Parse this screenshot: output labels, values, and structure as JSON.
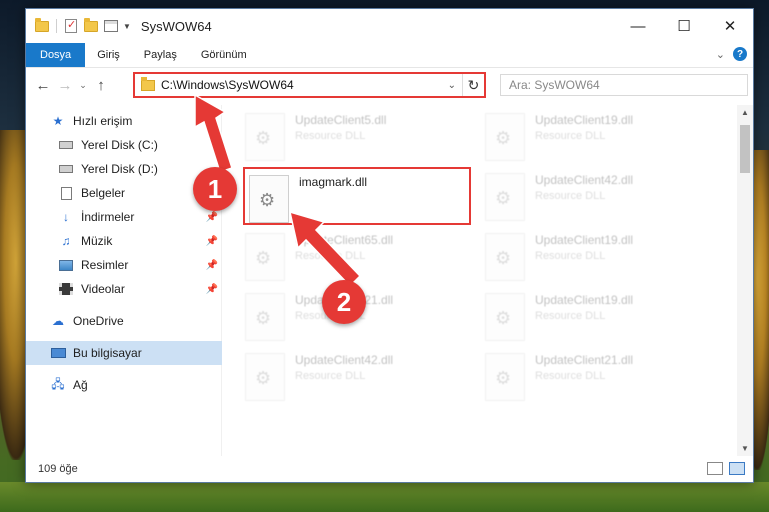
{
  "window": {
    "title": "SysWOW64"
  },
  "ribbon": {
    "tabs": [
      "Dosya",
      "Giriş",
      "Paylaş",
      "Görünüm"
    ],
    "help_label": "?"
  },
  "navigation": {
    "address": "C:\\Windows\\SysWOW64",
    "search_placeholder": "Ara: SysWOW64"
  },
  "sidebar": {
    "items": [
      {
        "label": "Hızlı erişim",
        "icon": "star-icon"
      },
      {
        "label": "Yerel Disk (C:)",
        "icon": "drive-icon"
      },
      {
        "label": "Yerel Disk (D:)",
        "icon": "drive-icon"
      },
      {
        "label": "Belgeler",
        "icon": "documents-icon"
      },
      {
        "label": "İndirmeler",
        "icon": "download-icon"
      },
      {
        "label": "Müzik",
        "icon": "music-icon"
      },
      {
        "label": "Resimler",
        "icon": "pictures-icon"
      },
      {
        "label": "Videolar",
        "icon": "video-icon"
      },
      {
        "label": "OneDrive",
        "icon": "cloud-icon"
      },
      {
        "label": "Bu bilgisayar",
        "icon": "computer-icon"
      },
      {
        "label": "Ağ",
        "icon": "network-icon"
      }
    ]
  },
  "files": [
    {
      "name": "UpdateClient5.dll",
      "desc": "Resource DLL"
    },
    {
      "name": "UpdateClient19.dll",
      "desc": "Resource DLL"
    },
    {
      "name": "imagmark.dll",
      "desc": ""
    },
    {
      "name": "UpdateClient42.dll",
      "desc": "Resource DLL"
    },
    {
      "name": "UpdateClient65.dll",
      "desc": "Resource DLL"
    },
    {
      "name": "UpdateClient19.dll",
      "desc": "Resource DLL"
    },
    {
      "name": "UpdateClient21.dll",
      "desc": "Resource DLL"
    },
    {
      "name": "UpdateClient19.dll",
      "desc": "Resource DLL"
    },
    {
      "name": "UpdateClient42.dll",
      "desc": "Resource DLL"
    },
    {
      "name": "UpdateClient21.dll",
      "desc": "Resource DLL"
    }
  ],
  "status": {
    "item_count": "109 öğe"
  },
  "annotations": {
    "badge1": "1",
    "badge2": "2",
    "color": "#e53935"
  }
}
